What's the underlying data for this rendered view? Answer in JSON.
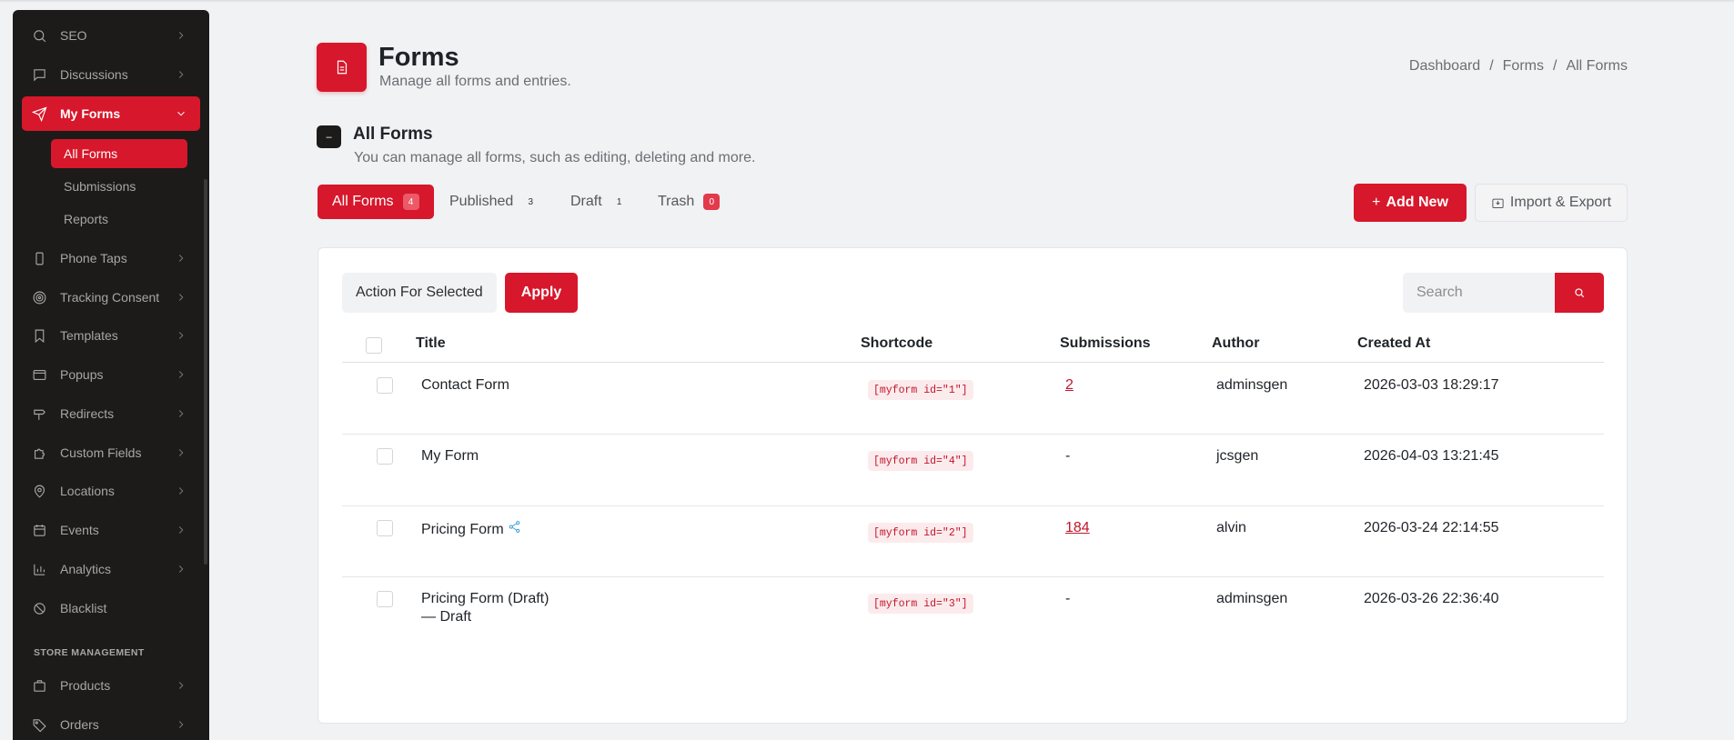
{
  "sidebar": {
    "items": [
      {
        "label": "SEO",
        "icon": "search-icon"
      },
      {
        "label": "Discussions",
        "icon": "message-square-icon"
      },
      {
        "label": "My Forms",
        "icon": "send-icon"
      },
      {
        "label": "Phone Taps",
        "icon": "smartphone-icon"
      },
      {
        "label": "Tracking Consent",
        "icon": "target-icon"
      },
      {
        "label": "Templates",
        "icon": "bookmark-icon"
      },
      {
        "label": "Popups",
        "icon": "window-icon"
      },
      {
        "label": "Redirects",
        "icon": "signpost-icon"
      },
      {
        "label": "Custom Fields",
        "icon": "puzzle-icon"
      },
      {
        "label": "Locations",
        "icon": "map-pin-icon"
      },
      {
        "label": "Events",
        "icon": "calendar-icon"
      },
      {
        "label": "Analytics",
        "icon": "bar-chart-icon"
      },
      {
        "label": "Blacklist",
        "icon": "ban-icon"
      },
      {
        "label": "Products",
        "icon": "box-icon"
      },
      {
        "label": "Orders",
        "icon": "tag-icon"
      }
    ],
    "subitems": [
      {
        "label": "All Forms"
      },
      {
        "label": "Submissions"
      },
      {
        "label": "Reports"
      }
    ],
    "section_label": "STORE MANAGEMENT",
    "accent": "#d7172b"
  },
  "header": {
    "title": "Forms",
    "subtitle": "Manage all forms and entries.",
    "icon": "file-text-icon"
  },
  "breadcrumb": [
    "Dashboard",
    "Forms",
    "All Forms"
  ],
  "section": {
    "title": "All Forms",
    "subtitle": "You can manage all forms, such as editing, deleting and more.",
    "icon_glyph": "–"
  },
  "tabs": [
    {
      "label": "All Forms",
      "count": "4"
    },
    {
      "label": "Published",
      "count": "3"
    },
    {
      "label": "Draft",
      "count": "1"
    },
    {
      "label": "Trash",
      "count": "0"
    }
  ],
  "actions": {
    "add_new": "Add New",
    "add_glyph": "+",
    "import_export": "Import & Export"
  },
  "toolbar": {
    "bulk_action": "Action For Selected",
    "apply": "Apply",
    "search_placeholder": "Search"
  },
  "table": {
    "columns": [
      "Title",
      "Shortcode",
      "Submissions",
      "Author",
      "Created At"
    ],
    "rows": [
      {
        "title": "Contact Form",
        "note": "",
        "shortcode": "[myform id=\"1\"]",
        "submissions": "2",
        "author": "adminsgen",
        "created": "2026-03-03 18:29:17"
      },
      {
        "title": "My Form",
        "note": "",
        "shortcode": "[myform id=\"4\"]",
        "submissions": "-",
        "author": "jcsgen",
        "created": "2026-04-03 13:21:45"
      },
      {
        "title": "Pricing Form",
        "note": "",
        "shortcode": "[myform id=\"2\"]",
        "submissions": "184",
        "author": "alvin",
        "created": "2026-03-24 22:14:55"
      },
      {
        "title": "Pricing Form (Draft)",
        "note": "— Draft",
        "shortcode": "[myform id=\"3\"]",
        "submissions": "-",
        "author": "adminsgen",
        "created": "2026-03-26 22:36:40"
      }
    ]
  }
}
